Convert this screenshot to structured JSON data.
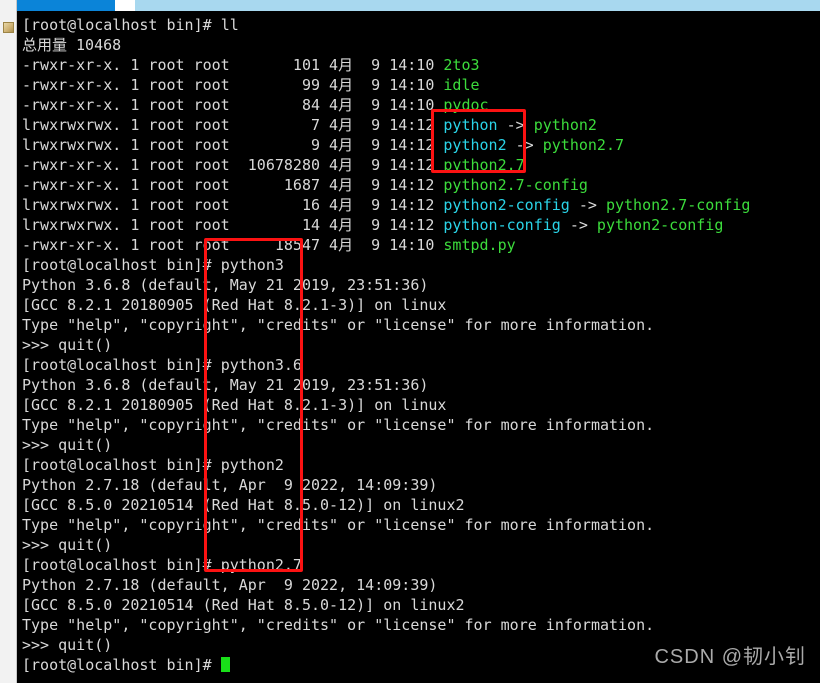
{
  "window": {
    "scrollbar": {
      "name": "horizontal-scrollbar"
    },
    "gutter_icon": "folder-icon"
  },
  "terminal": {
    "prompt": "[root@localhost bin]#",
    "ps2": ">>>",
    "cursor": "block-cursor",
    "lines": [
      {
        "type": "prompt",
        "prompt": "[root@localhost bin]# ",
        "command": "ll"
      },
      {
        "type": "plain",
        "text": "总用量 10468"
      },
      {
        "type": "listing",
        "perms": "-rwxr-xr-x.",
        "links": "1",
        "owner": "root",
        "group": "root",
        "size": "101",
        "month": "4月",
        "day": "9",
        "time": "14:10",
        "name": "2to3",
        "name_color": "green",
        "target": "",
        "target_color": ""
      },
      {
        "type": "listing",
        "perms": "-rwxr-xr-x.",
        "links": "1",
        "owner": "root",
        "group": "root",
        "size": "99",
        "month": "4月",
        "day": "9",
        "time": "14:10",
        "name": "idle",
        "name_color": "green",
        "target": "",
        "target_color": ""
      },
      {
        "type": "listing",
        "perms": "-rwxr-xr-x.",
        "links": "1",
        "owner": "root",
        "group": "root",
        "size": "84",
        "month": "4月",
        "day": "9",
        "time": "14:10",
        "name": "pydoc",
        "name_color": "green",
        "target": "",
        "target_color": ""
      },
      {
        "type": "listing",
        "perms": "lrwxrwxrwx.",
        "links": "1",
        "owner": "root",
        "group": "root",
        "size": "7",
        "month": "4月",
        "day": "9",
        "time": "14:12",
        "name": "python",
        "name_color": "cyan",
        "target": "python2",
        "target_color": "green"
      },
      {
        "type": "listing",
        "perms": "lrwxrwxrwx.",
        "links": "1",
        "owner": "root",
        "group": "root",
        "size": "9",
        "month": "4月",
        "day": "9",
        "time": "14:12",
        "name": "python2",
        "name_color": "cyan",
        "target": "python2.7",
        "target_color": "green"
      },
      {
        "type": "listing",
        "perms": "-rwxr-xr-x.",
        "links": "1",
        "owner": "root",
        "group": "root",
        "size": "10678280",
        "month": "4月",
        "day": "9",
        "time": "14:12",
        "name": "python2.7",
        "name_color": "green",
        "target": "",
        "target_color": ""
      },
      {
        "type": "listing",
        "perms": "-rwxr-xr-x.",
        "links": "1",
        "owner": "root",
        "group": "root",
        "size": "1687",
        "month": "4月",
        "day": "9",
        "time": "14:12",
        "name": "python2.7-config",
        "name_color": "green",
        "target": "",
        "target_color": ""
      },
      {
        "type": "listing",
        "perms": "lrwxrwxrwx.",
        "links": "1",
        "owner": "root",
        "group": "root",
        "size": "16",
        "month": "4月",
        "day": "9",
        "time": "14:12",
        "name": "python2-config",
        "name_color": "cyan",
        "target": "python2.7-config",
        "target_color": "green"
      },
      {
        "type": "listing",
        "perms": "lrwxrwxrwx.",
        "links": "1",
        "owner": "root",
        "group": "root",
        "size": "14",
        "month": "4月",
        "day": "9",
        "time": "14:12",
        "name": "python-config",
        "name_color": "cyan",
        "target": "python2-config",
        "target_color": "green"
      },
      {
        "type": "listing",
        "perms": "-rwxr-xr-x.",
        "links": "1",
        "owner": "root",
        "group": "root",
        "size": "18547",
        "month": "4月",
        "day": "9",
        "time": "14:10",
        "name": "smtpd.py",
        "name_color": "green",
        "target": "",
        "target_color": ""
      },
      {
        "type": "prompt",
        "prompt": "[root@localhost bin]# ",
        "command": "python3"
      },
      {
        "type": "plain",
        "text": "Python 3.6.8 (default, May 21 2019, 23:51:36)"
      },
      {
        "type": "plain",
        "text": "[GCC 8.2.1 20180905 (Red Hat 8.2.1-3)] on linux"
      },
      {
        "type": "plain",
        "text": "Type \"help\", \"copyright\", \"credits\" or \"license\" for more information."
      },
      {
        "type": "plain",
        "text": ">>> quit()"
      },
      {
        "type": "prompt",
        "prompt": "[root@localhost bin]# ",
        "command": "python3.6"
      },
      {
        "type": "plain",
        "text": "Python 3.6.8 (default, May 21 2019, 23:51:36)"
      },
      {
        "type": "plain",
        "text": "[GCC 8.2.1 20180905 (Red Hat 8.2.1-3)] on linux"
      },
      {
        "type": "plain",
        "text": "Type \"help\", \"copyright\", \"credits\" or \"license\" for more information."
      },
      {
        "type": "plain",
        "text": ">>> quit()"
      },
      {
        "type": "prompt",
        "prompt": "[root@localhost bin]# ",
        "command": "python2"
      },
      {
        "type": "plain",
        "text": "Python 2.7.18 (default, Apr  9 2022, 14:09:39)"
      },
      {
        "type": "plain",
        "text": "[GCC 8.5.0 20210514 (Red Hat 8.5.0-12)] on linux2"
      },
      {
        "type": "plain",
        "text": "Type \"help\", \"copyright\", \"credits\" or \"license\" for more information."
      },
      {
        "type": "plain",
        "text": ">>> quit()"
      },
      {
        "type": "prompt",
        "prompt": "[root@localhost bin]# ",
        "command": "python2.7"
      },
      {
        "type": "plain",
        "text": "Python 2.7.18 (default, Apr  9 2022, 14:09:39)"
      },
      {
        "type": "plain",
        "text": "[GCC 8.5.0 20210514 (Red Hat 8.5.0-12)] on linux2"
      },
      {
        "type": "plain",
        "text": "Type \"help\", \"copyright\", \"credits\" or \"license\" for more information."
      },
      {
        "type": "plain",
        "text": ">>> quit()"
      },
      {
        "type": "cursor-prompt",
        "prompt": "[root@localhost bin]# ",
        "command": ""
      }
    ]
  },
  "annotations": [
    {
      "name": "redbox-symlinks",
      "label": ""
    },
    {
      "name": "redbox-commands",
      "label": ""
    }
  ],
  "watermark": {
    "text": "CSDN @韧小钊"
  },
  "colors": {
    "background": "#000000",
    "foreground": "#d9d9d9",
    "executable": "#3cdc3c",
    "symlink": "#2ad4e8",
    "annotation": "#fc1212",
    "cursor": "#19e019",
    "scrollbar_thumb": "#0b84d8",
    "scrollbar_track": "#a8d8ef"
  }
}
